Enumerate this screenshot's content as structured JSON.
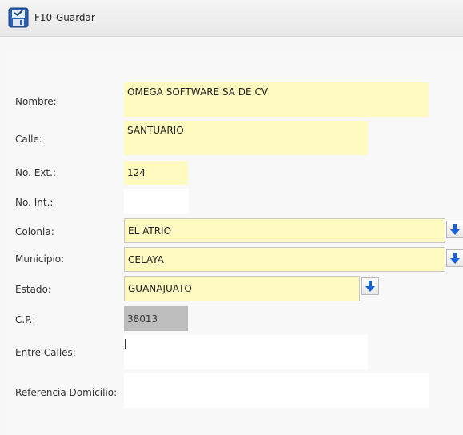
{
  "toolbar": {
    "save_label": "F10-Guardar",
    "save_icon": "floppy-save-icon"
  },
  "form": {
    "nombre": {
      "label": "Nombre:",
      "value": "OMEGA SOFTWARE SA DE CV"
    },
    "calle": {
      "label": "Calle:",
      "value": "SANTUARIO"
    },
    "no_ext": {
      "label": "No. Ext.:",
      "value": "124"
    },
    "no_int": {
      "label": "No. Int.:",
      "value": ""
    },
    "colonia": {
      "label": "Colonia:",
      "value": "EL ATRIO",
      "dropdown_icon": "arrow-down-icon"
    },
    "municipio": {
      "label": "Municipio:",
      "value": "CELAYA",
      "dropdown_icon": "arrow-down-icon"
    },
    "estado": {
      "label": "Estado:",
      "value": "GUANAJUATO",
      "dropdown_icon": "arrow-down-icon"
    },
    "cp": {
      "label": "C.P.:",
      "value": "38013"
    },
    "entre_calles": {
      "label": "Entre Calles:",
      "value": ""
    },
    "referencia": {
      "label": "Referencia Domicilio:",
      "value": ""
    }
  },
  "colors": {
    "field_yellow": "#fffbc0",
    "field_white": "#ffffff",
    "field_disabled": "#bdbdbd",
    "arrow_blue": "#1565d8"
  }
}
